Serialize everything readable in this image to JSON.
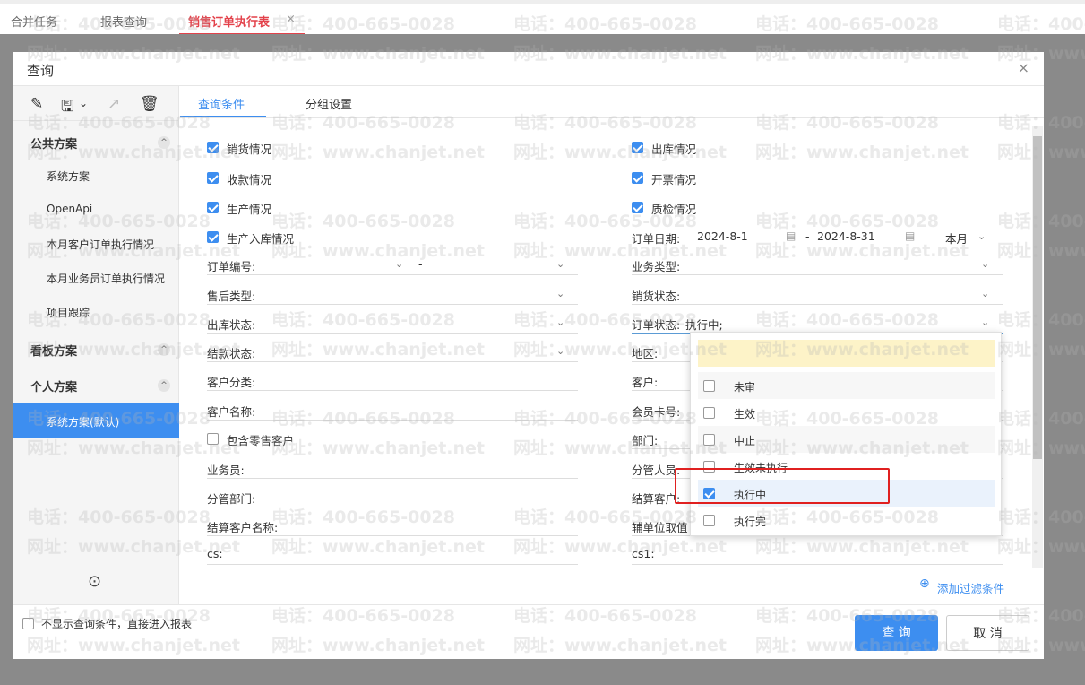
{
  "tabs": [
    {
      "label": "合并任务"
    },
    {
      "label": "报表查询"
    },
    {
      "label": "销售订单执行表",
      "active": true
    }
  ],
  "tab_close": "×",
  "dialog": {
    "title": "查询",
    "close": "×"
  },
  "toolbar": {
    "edit": "✎",
    "save": "🖫",
    "save_menu": "⌄",
    "export": "↗",
    "delete": "🗑"
  },
  "sidebar": {
    "groups": [
      {
        "label": "公共方案",
        "items": [
          "系统方案",
          "OpenApi",
          "本月客户订单执行情况",
          "本月业务员订单执行情况",
          "项目跟踪"
        ]
      },
      {
        "label": "看板方案",
        "items": []
      },
      {
        "label": "个人方案",
        "items": [
          "系统方案(默认)"
        ]
      }
    ],
    "collapse": "⊙"
  },
  "content_tabs": [
    {
      "label": "查询条件",
      "active": true
    },
    {
      "label": "分组设置"
    }
  ],
  "left_checks": [
    {
      "label": "销货情况",
      "checked": true
    },
    {
      "label": "收款情况",
      "checked": true
    },
    {
      "label": "生产情况",
      "checked": true
    },
    {
      "label": "生产入库情况",
      "checked": true
    }
  ],
  "right_checks": [
    {
      "label": "出库情况",
      "checked": true
    },
    {
      "label": "开票情况",
      "checked": true
    },
    {
      "label": "质检情况",
      "checked": true
    }
  ],
  "order_date": {
    "label": "订单日期:",
    "from": "2024-8-1",
    "sep": "-",
    "to": "2024-8-31",
    "period": "本月"
  },
  "order_no": {
    "label": "订单编号:",
    "sep": "-"
  },
  "left_fields": [
    {
      "label": "售后类型:",
      "dropdown": true
    },
    {
      "label": "出库状态:",
      "dropdown": true
    },
    {
      "label": "结款状态:",
      "dropdown": true
    },
    {
      "label": "客户分类:"
    },
    {
      "label": "客户名称:"
    },
    {
      "label": "包含零售客户",
      "checkbox": true,
      "checked": false
    },
    {
      "label": "业务员:"
    },
    {
      "label": "分管部门:"
    },
    {
      "label": "结算客户名称:"
    },
    {
      "label": "cs:"
    }
  ],
  "right_fields": [
    {
      "label": "业务类型:",
      "dropdown": true
    },
    {
      "label": "销货状态:",
      "dropdown": true
    },
    {
      "label": "订单状态:",
      "value": "执行中;",
      "dropdown": true
    },
    {
      "label": "地区:"
    },
    {
      "label": "客户:"
    },
    {
      "label": "会员卡号:"
    },
    {
      "label": "部门:"
    },
    {
      "label": "分管人员:"
    },
    {
      "label": "结算客户:"
    },
    {
      "label": "辅单位取值"
    },
    {
      "label": "cs1:"
    }
  ],
  "status_options": [
    {
      "label": "未审",
      "checked": false
    },
    {
      "label": "生效",
      "checked": false
    },
    {
      "label": "中止",
      "checked": false
    },
    {
      "label": "生效未执行",
      "checked": false
    },
    {
      "label": "执行中",
      "checked": true
    },
    {
      "label": "执行完",
      "checked": false
    }
  ],
  "add_filter": "添加过滤条件",
  "footer": {
    "skip_label": "不显示查询条件，直接进入报表",
    "query": "查 询",
    "cancel": "取 消"
  },
  "watermark": {
    "phone": "电话：400-665-0028",
    "site": "网址：www.chanjet.net"
  },
  "colors": {
    "accent": "#3d8ef0",
    "active_tab": "#e3424b",
    "highlight": "#e02020"
  }
}
